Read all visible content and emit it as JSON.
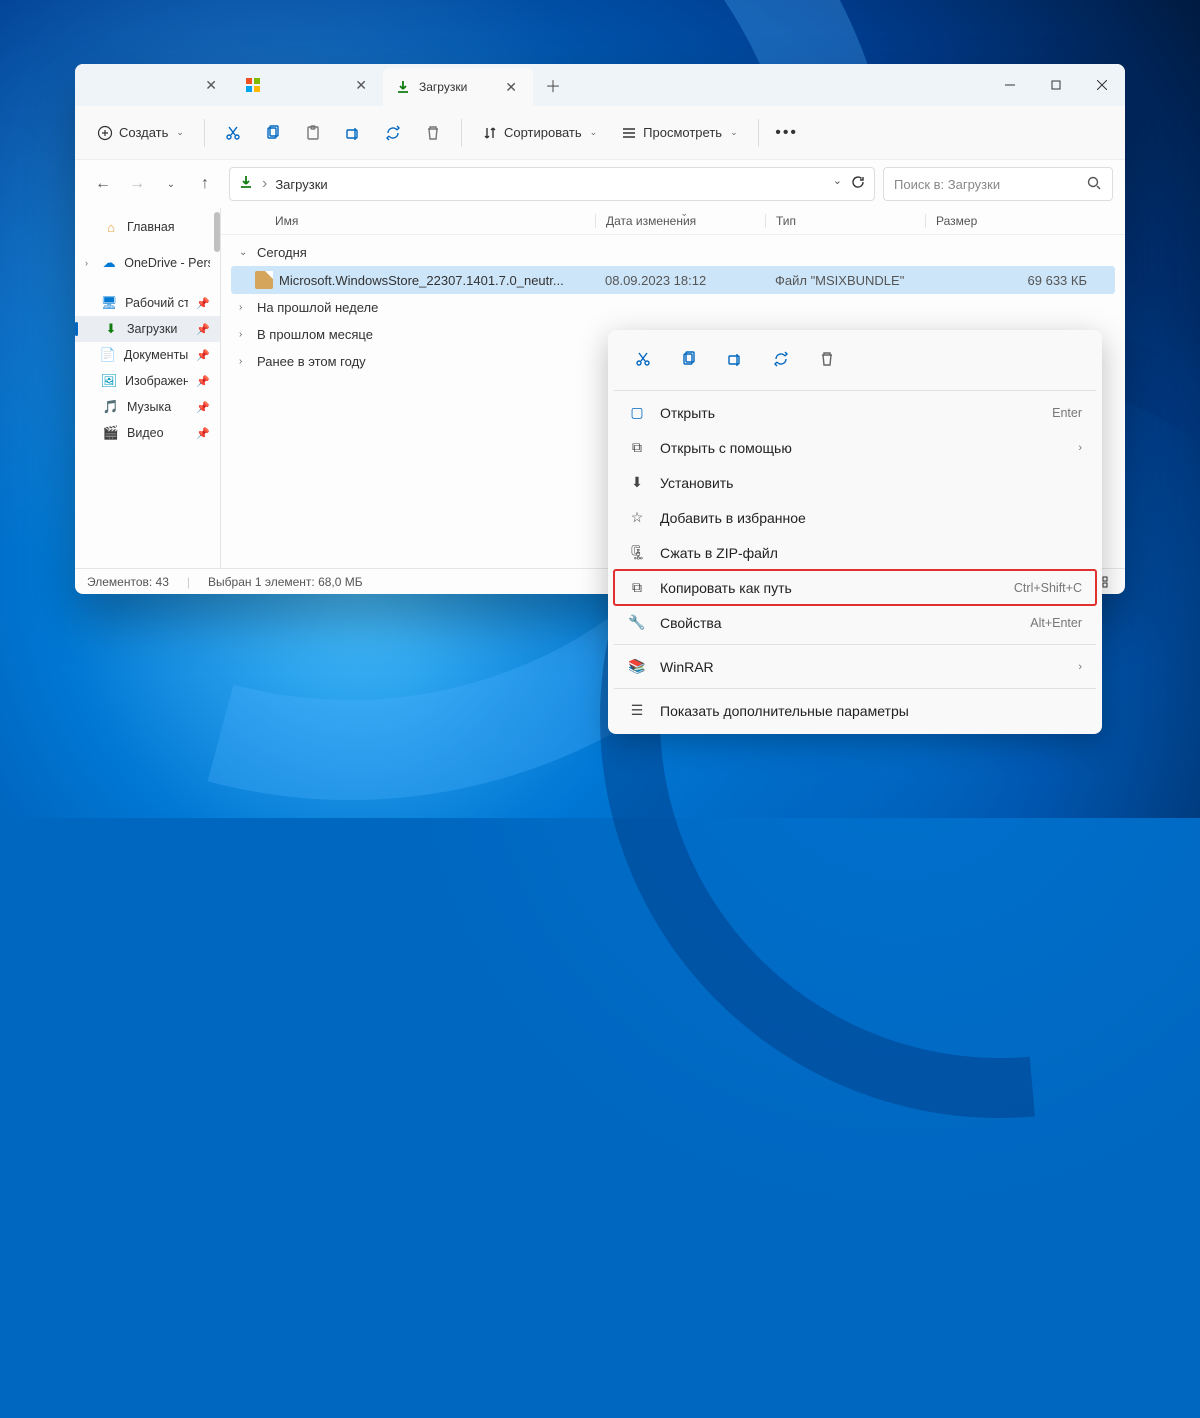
{
  "tabs": [
    {
      "label": "",
      "active": false
    },
    {
      "label": "",
      "active": false
    },
    {
      "label": "Загрузки",
      "active": true
    }
  ],
  "toolbar": {
    "new": "Создать",
    "sort": "Сортировать",
    "view": "Просмотреть"
  },
  "addressbar": {
    "location": "Загрузки",
    "separator": "›"
  },
  "search": {
    "placeholder": "Поиск в: Загрузки"
  },
  "columns": {
    "name": "Имя",
    "date": "Дата изменения",
    "type": "Тип",
    "size": "Размер"
  },
  "sidebar": {
    "home": "Главная",
    "onedrive": "OneDrive - Persc",
    "desktop": "Рабочий стол",
    "downloads": "Загрузки",
    "documents": "Документы",
    "pictures": "Изображения",
    "music": "Музыка",
    "video": "Видео"
  },
  "groups": {
    "today": "Сегодня",
    "lastweek": "На прошлой неделе",
    "lastmonth": "В прошлом месяце",
    "earlier": "Ранее в этом году"
  },
  "file": {
    "name": "Microsoft.WindowsStore_22307.1401.7.0_neutr...",
    "date": "08.09.2023 18:12",
    "type": "Файл \"MSIXBUNDLE\"",
    "size": "69 633 КБ"
  },
  "status": {
    "count": "Элементов: 43",
    "selection": "Выбран 1 элемент: 68,0 МБ"
  },
  "ctx": {
    "open": "Открыть",
    "open_hint": "Enter",
    "openwith": "Открыть с помощью",
    "install": "Установить",
    "favorite": "Добавить в избранное",
    "zip": "Сжать в ZIP-файл",
    "copypath": "Копировать как путь",
    "copypath_hint": "Ctrl+Shift+C",
    "properties": "Свойства",
    "properties_hint": "Alt+Enter",
    "winrar": "WinRAR",
    "more": "Показать дополнительные параметры"
  }
}
